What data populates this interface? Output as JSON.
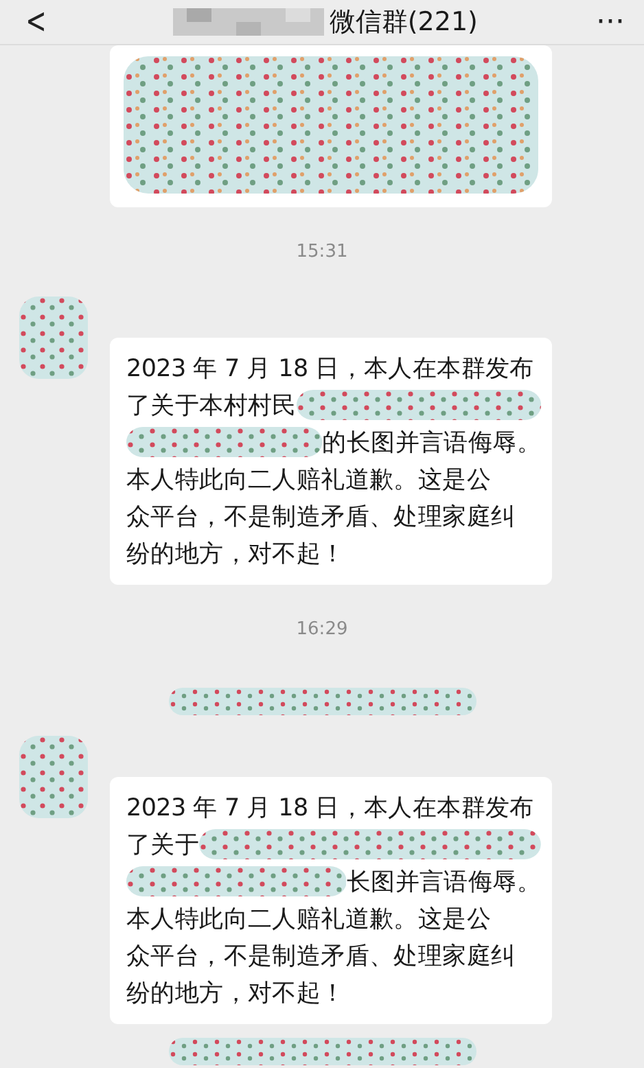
{
  "header": {
    "back": "<",
    "title": "微信群(221)",
    "more": "···"
  },
  "messages": [
    {
      "kind": "redacted_message"
    },
    {
      "kind": "time",
      "text": "15:31"
    },
    {
      "kind": "message",
      "lines": [
        {
          "parts": [
            {
              "kind": "text",
              "text": "2023 年 7 月 18 日，本人在本群发布"
            }
          ]
        },
        {
          "parts": [
            {
              "kind": "text",
              "text": "了关于本村村民"
            },
            {
              "kind": "redacted"
            }
          ]
        },
        {
          "parts": [
            {
              "kind": "redacted"
            },
            {
              "kind": "text",
              "text": "的长图并言语侮辱。"
            }
          ]
        },
        {
          "parts": [
            {
              "kind": "text",
              "text": "本人特此向二人赔礼道歉。这是公"
            }
          ]
        },
        {
          "parts": [
            {
              "kind": "text",
              "text": "众平台，不是制造矛盾、处理家庭纠"
            }
          ]
        },
        {
          "parts": [
            {
              "kind": "text",
              "text": "纷的地方，对不起！"
            }
          ]
        }
      ]
    },
    {
      "kind": "time",
      "text": "16:29"
    },
    {
      "kind": "redacted_notice"
    },
    {
      "kind": "message",
      "lines": [
        {
          "parts": [
            {
              "kind": "text",
              "text": "2023 年 7 月 18 日，本人在本群发布"
            }
          ]
        },
        {
          "parts": [
            {
              "kind": "text",
              "text": "了关于"
            },
            {
              "kind": "redacted"
            }
          ]
        },
        {
          "parts": [
            {
              "kind": "redacted"
            },
            {
              "kind": "text",
              "text": "长图并言语侮辱。"
            }
          ]
        },
        {
          "parts": [
            {
              "kind": "text",
              "text": "本人特此向二人赔礼道歉。这是公"
            }
          ]
        },
        {
          "parts": [
            {
              "kind": "text",
              "text": "众平台，不是制造矛盾、处理家庭纠"
            }
          ]
        },
        {
          "parts": [
            {
              "kind": "text",
              "text": "纷的地方，对不起！"
            }
          ]
        }
      ]
    },
    {
      "kind": "redacted_notice"
    }
  ]
}
